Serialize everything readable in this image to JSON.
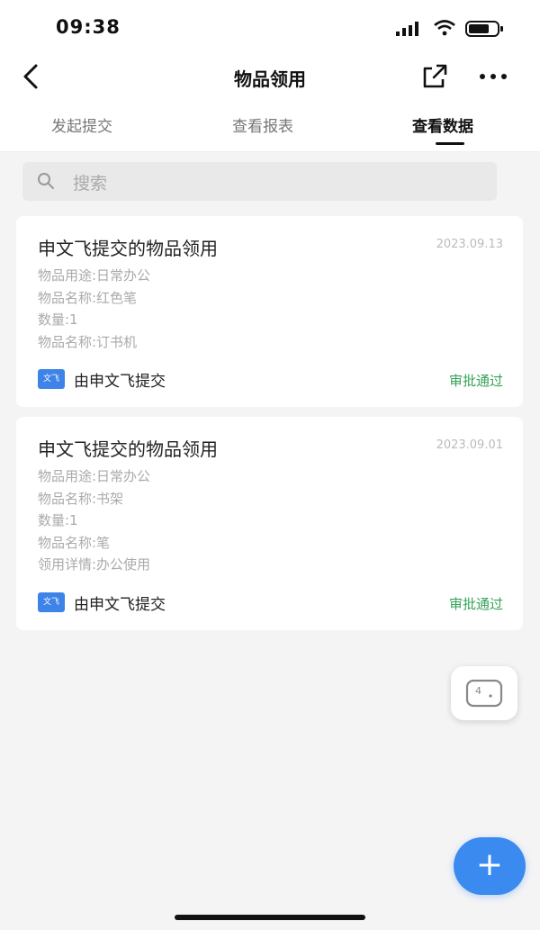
{
  "status_bar": {
    "time": "09:38"
  },
  "nav": {
    "title": "物品领用"
  },
  "tabs": [
    {
      "label": "发起提交"
    },
    {
      "label": "查看报表"
    },
    {
      "label": "查看数据"
    }
  ],
  "search": {
    "placeholder": "搜索"
  },
  "records": [
    {
      "title": "申文飞提交的物品领用",
      "date": "2023.09.13",
      "fields": [
        "物品用途:日常办公",
        "物品名称:红色笔",
        "数量:1",
        "物品名称:订书机"
      ],
      "avatar_text": "文飞",
      "submitter": "由申文飞提交",
      "status": "审批通过"
    },
    {
      "title": "申文飞提交的物品领用",
      "date": "2023.09.01",
      "fields": [
        "物品用途:日常办公",
        "物品名称:书架",
        "数量:1",
        "物品名称:笔",
        "领用详情:办公使用"
      ],
      "avatar_text": "文飞",
      "submitter": "由申文飞提交",
      "status": "审批通过"
    }
  ],
  "fab": {
    "label": "+"
  },
  "colors": {
    "accent": "#3a8af0",
    "status_green": "#35a357",
    "avatar_blue": "#3e84e8"
  }
}
